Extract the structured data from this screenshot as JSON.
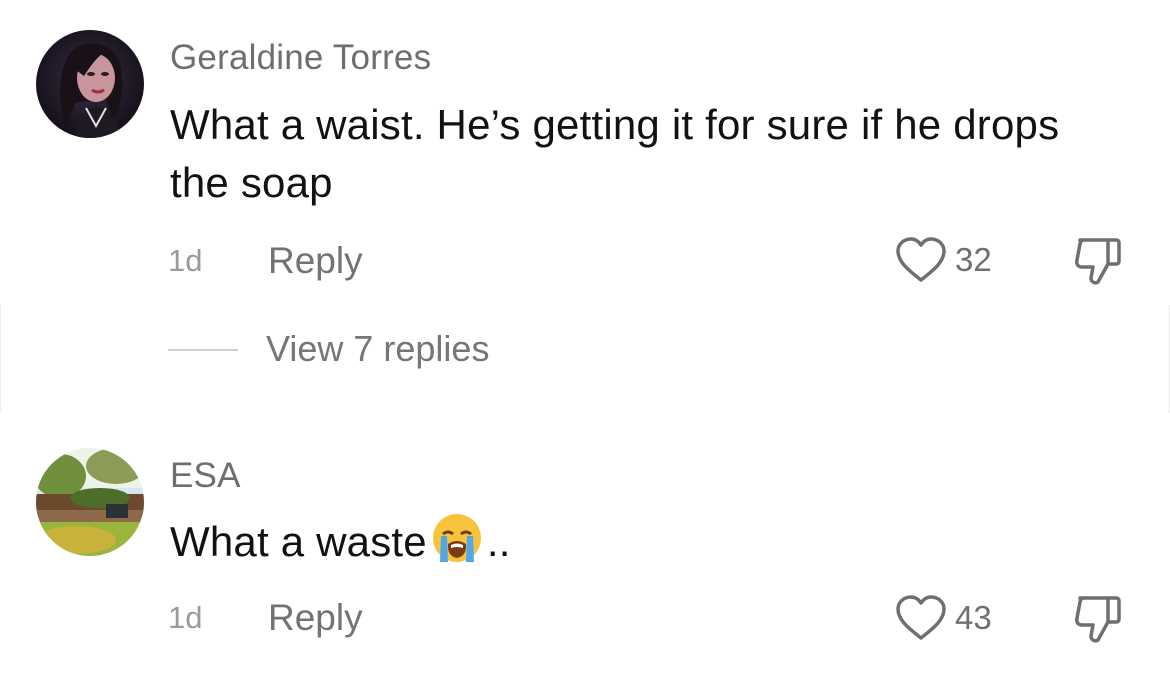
{
  "comments": [
    {
      "username": "Geraldine Torres",
      "text": "What a waist. He’s getting it for sure if he drops the soap",
      "time": "1d",
      "reply_label": "Reply",
      "likes": "32",
      "view_replies": "View 7 replies"
    },
    {
      "username": "ESA",
      "text_before_emoji": "What a waste",
      "emoji": "loudly-crying-face",
      "text_after_emoji": "..",
      "time": "1d",
      "reply_label": "Reply",
      "likes": "43"
    }
  ],
  "icons": {
    "like": "heart-outline-icon",
    "dislike": "thumbs-down-outline-icon"
  },
  "colors": {
    "username": "#6e6e6e",
    "text": "#121212",
    "meta": "#9a9a9a",
    "reply": "#737373",
    "icon": "#6f6f6f"
  }
}
